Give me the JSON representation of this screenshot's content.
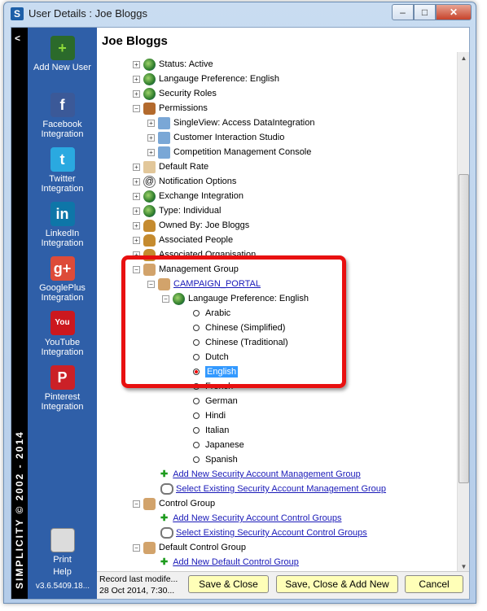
{
  "window": {
    "title": "User Details : Joe Bloggs",
    "app_icon_letter": "S",
    "minimize": "–",
    "maximize": "□",
    "close": "✕"
  },
  "sidebar": {
    "collapse": "<",
    "copyright": "SIMPLICITY © 2002 - 2014",
    "items": [
      {
        "label": "Add New User",
        "icon": "add-user-icon",
        "color": "#2f7d2f"
      },
      {
        "label": "Facebook Integration",
        "icon": "facebook-icon",
        "color": "#3b5998",
        "glyph": "f"
      },
      {
        "label": "Twitter Integration",
        "icon": "twitter-icon",
        "color": "#2aa9e0",
        "glyph": "t"
      },
      {
        "label": "LinkedIn Integration",
        "icon": "linkedin-icon",
        "color": "#0e76a8",
        "glyph": "in"
      },
      {
        "label": "GooglePlus Integration",
        "icon": "googleplus-icon",
        "color": "#dd4b39",
        "glyph": "g+"
      },
      {
        "label": "YouTube Integration",
        "icon": "youtube-icon",
        "color": "#cc181e",
        "glyph": "You"
      },
      {
        "label": "Pinterest Integration",
        "icon": "pinterest-icon",
        "color": "#cb2027",
        "glyph": "P"
      },
      {
        "label": "Print",
        "icon": "printer-icon",
        "color": "#dcdcdc"
      },
      {
        "label": "Help",
        "icon": "help-icon"
      }
    ],
    "version": "v3.6.5409.18..."
  },
  "main": {
    "title": "Joe Bloggs",
    "tree": [
      {
        "text": "Status:  Active",
        "exp": "+",
        "icon": "globe"
      },
      {
        "text": "Langauge Preference:  English",
        "exp": "+",
        "icon": "globe"
      },
      {
        "text": "Security Roles",
        "exp": "+",
        "icon": "globe"
      },
      {
        "text": "Permissions",
        "exp": "−",
        "icon": "perm"
      },
      {
        "text": "SingleView:  Access DataIntegration",
        "exp": "+",
        "icon": "sv"
      },
      {
        "text": "Customer Interaction Studio",
        "exp": "+",
        "icon": "sv"
      },
      {
        "text": "Competition Management Console",
        "exp": "+",
        "icon": "sv"
      },
      {
        "text": "Default Rate",
        "exp": "+",
        "icon": "rate"
      },
      {
        "text": "Notification Options",
        "exp": "+",
        "icon": "at"
      },
      {
        "text": "Exchange Integration",
        "exp": "+",
        "icon": "globe"
      },
      {
        "text": "Type:  Individual",
        "exp": "+",
        "icon": "globe"
      },
      {
        "text": "Owned By:  Joe Bloggs",
        "exp": "+",
        "icon": "user"
      },
      {
        "text": "Associated People",
        "exp": "+",
        "icon": "user"
      },
      {
        "text": "Associated Organisation",
        "exp": "+",
        "icon": "user"
      },
      {
        "text": "Management Group",
        "exp": "−",
        "icon": "hands"
      },
      {
        "text": "CAMPAIGN_PORTAL",
        "exp": "−",
        "icon": "hands",
        "link": true
      },
      {
        "text": "Langauge Preference:  English",
        "exp": "−",
        "icon": "globe"
      }
    ],
    "languages": [
      "Arabic",
      "Chinese (Simplified)",
      "Chinese (Traditional)",
      "Dutch",
      "English",
      "French",
      "German",
      "Hindi",
      "Italian",
      "Japanese",
      "Spanish"
    ],
    "selected_language": "English",
    "links": [
      {
        "text": "Add New Security Account Management Group",
        "type": "add"
      },
      {
        "text": "Select Existing Security Account Management Group",
        "type": "select"
      }
    ],
    "control_group": "Control Group",
    "control_links": [
      {
        "text": "Add New Security Account Control Groups",
        "type": "add"
      },
      {
        "text": "Select Existing Security Account Control Groups",
        "type": "select"
      }
    ],
    "default_control_group": "Default Control Group",
    "default_control_links": [
      {
        "text": "Add New Default Control Group",
        "type": "add"
      }
    ]
  },
  "footer": {
    "record_line1": "Record last modife...",
    "record_line2": "28 Oct 2014, 7:30...",
    "save_close": "Save & Close",
    "save_close_add": "Save, Close & Add New",
    "cancel": "Cancel"
  },
  "colors": {
    "highlight": "#e81010",
    "rail": "#2f5fa8",
    "button": "#ffffb8",
    "link": "#1a1ab8"
  }
}
